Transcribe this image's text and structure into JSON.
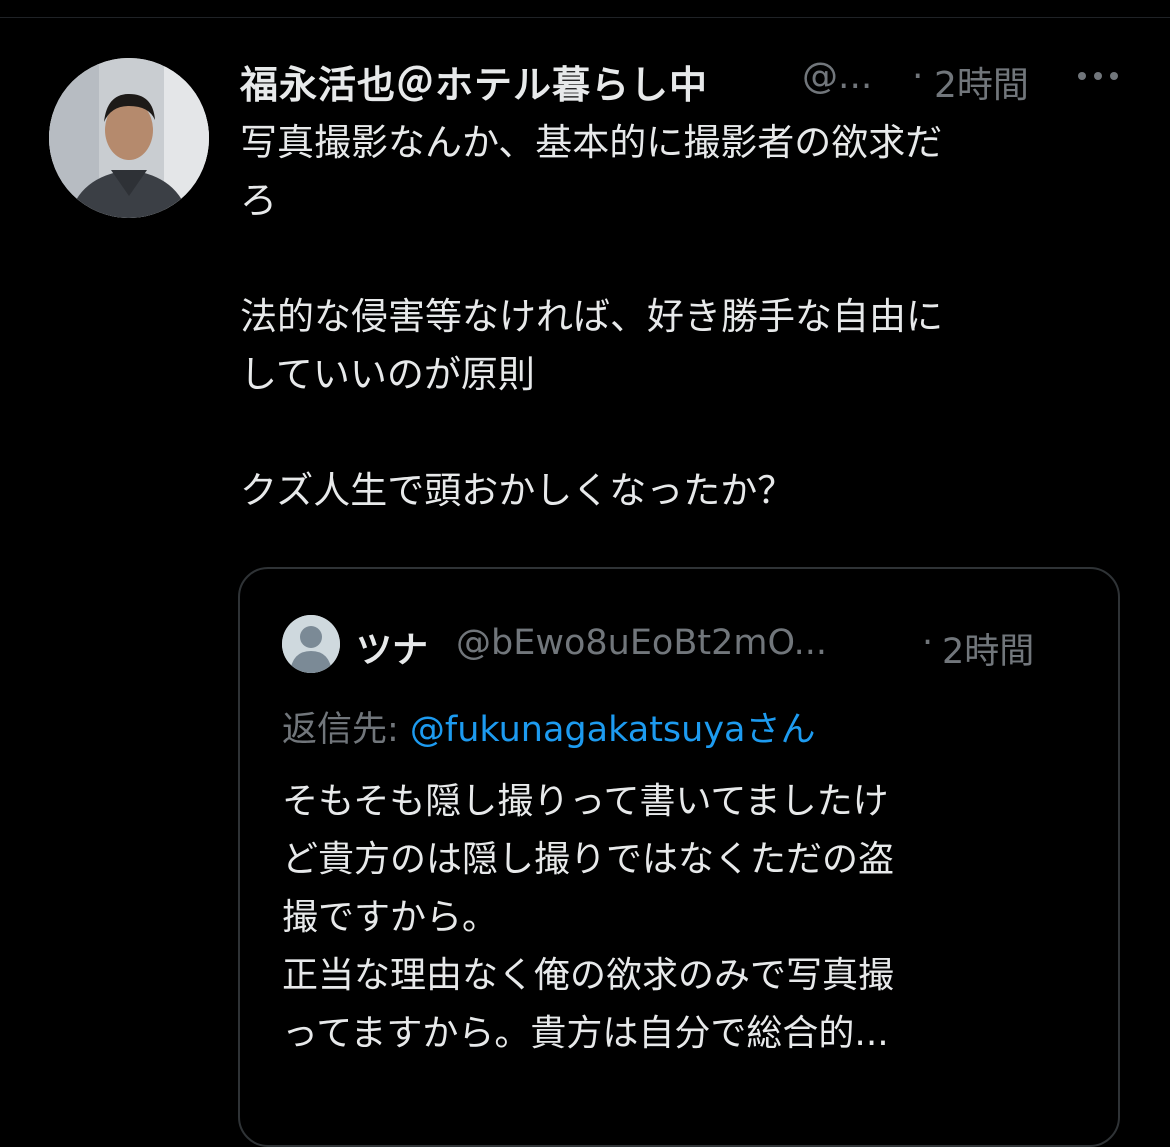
{
  "tweet": {
    "display_name": "福永活也＠ホテル暮らし中",
    "handle": "@...",
    "separator": "·",
    "time": "2時間",
    "text": "写真撮影なんか、基本的に撮影者の欲求だ\nろ\n\n法的な侵害等なければ、好き勝手な自由に\nしていいのが原則\n\nクズ人生で頭おかしくなったか？",
    "more_icon": "more-horizontal-icon"
  },
  "quote": {
    "display_name": "ツナ",
    "handle": "@bEwo8uEoBt2mO...",
    "separator": "·",
    "time": "2時間",
    "reply_label": "返信先: ",
    "reply_mention": "@fukunagakatsuya",
    "reply_suffix": "さん",
    "text": "そもそも隠し撮りって書いてましたけ\nど貴方のは隠し撮りではなくただの盗\n撮ですから。\n正当な理由なく俺の欲求のみで写真撮\nってますから。貴方は自分で総合的..."
  },
  "colors": {
    "background": "#000000",
    "text_primary": "#e7e9ea",
    "text_secondary": "#71767b",
    "link": "#1d9bf0",
    "border": "#2f3336"
  }
}
